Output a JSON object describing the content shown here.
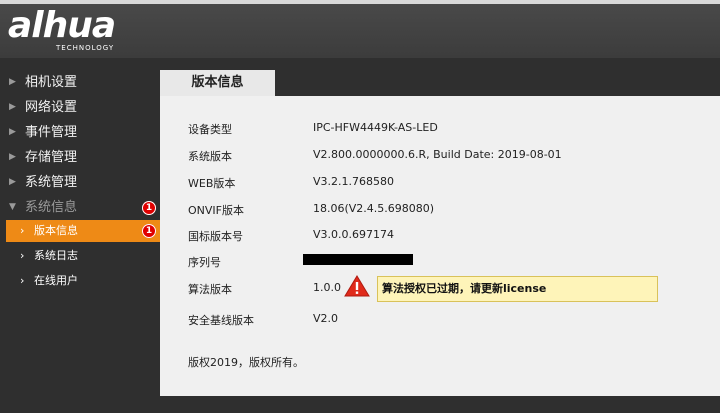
{
  "header": {
    "logo": "alhua",
    "logo_sub": "TECHNOLOGY"
  },
  "sidebar": {
    "items": [
      {
        "label": "相机设置"
      },
      {
        "label": "网络设置"
      },
      {
        "label": "事件管理"
      },
      {
        "label": "存储管理"
      },
      {
        "label": "系统管理"
      },
      {
        "label": "系统信息",
        "badge": "1"
      }
    ],
    "subitems": [
      {
        "label": "版本信息",
        "badge": "1"
      },
      {
        "label": "系统日志"
      },
      {
        "label": "在线用户"
      }
    ]
  },
  "main": {
    "tab": "版本信息",
    "rows": [
      {
        "key": "设备类型",
        "value": "IPC-HFW4449K-AS-LED"
      },
      {
        "key": "系统版本",
        "value": "V2.800.0000000.6.R, Build Date: 2019-08-01"
      },
      {
        "key": "WEB版本",
        "value": "V3.2.1.768580"
      },
      {
        "key": "ONVIF版本",
        "value": "18.06(V2.4.5.698080)"
      },
      {
        "key": "国标版本号",
        "value": "V3.0.0.697174"
      },
      {
        "key": "序列号",
        "value": ""
      },
      {
        "key": "算法版本",
        "value": "1.0.0"
      },
      {
        "key": "安全基线版本",
        "value": "V2.0"
      }
    ],
    "warning": "算法授权已过期，请更新license",
    "copyright": "版权2019，版权所有。"
  },
  "colors": {
    "accent": "#ee8a16",
    "badge": "#e00000",
    "warning_bg": "#fef4b9"
  }
}
